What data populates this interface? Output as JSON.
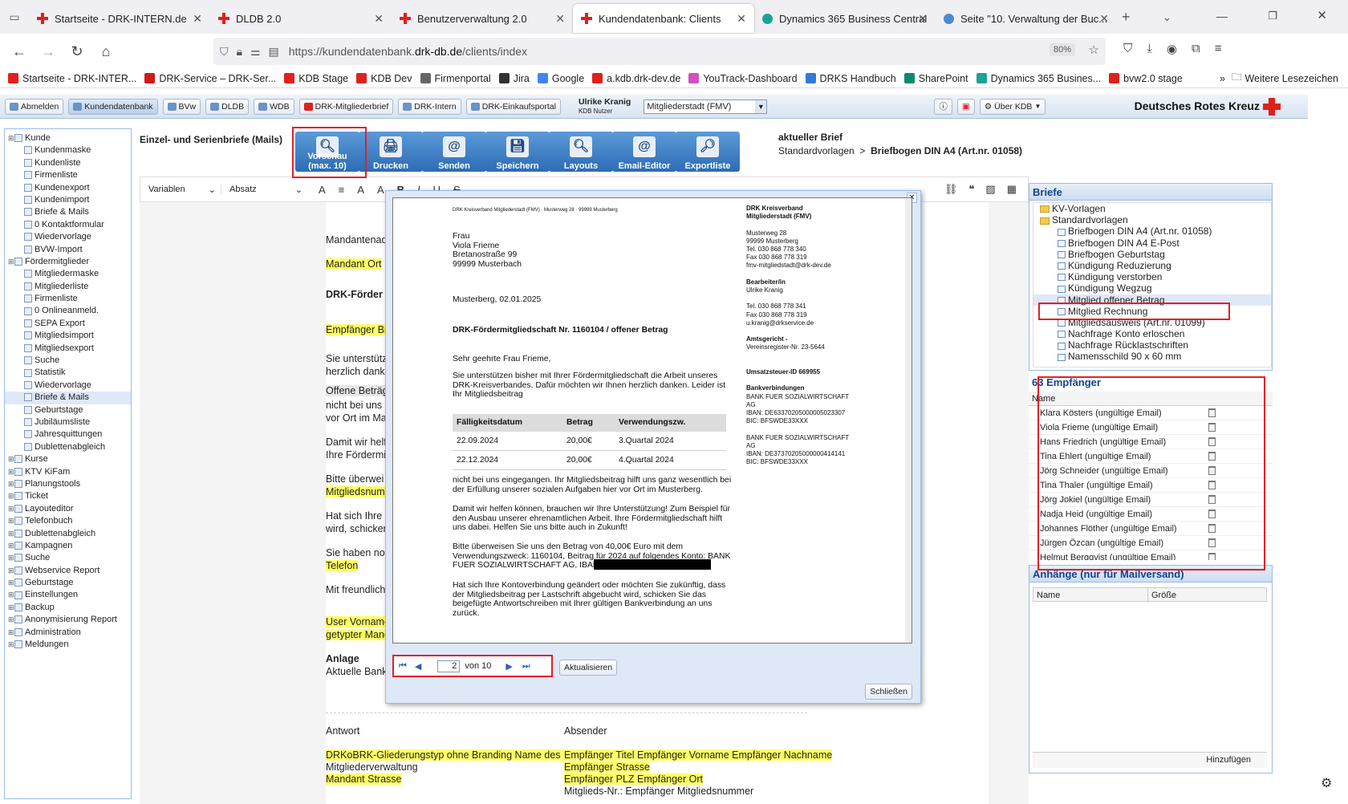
{
  "browser": {
    "tabs": [
      {
        "label": "Startseite - DRK-INTERN.de",
        "icon": "drk-cross-icon"
      },
      {
        "label": "DLDB 2.0",
        "icon": "drk-cross-icon"
      },
      {
        "label": "Benutzerverwaltung 2.0",
        "icon": "drk-cross-icon"
      },
      {
        "label": "Kundendatenbank: Clients",
        "icon": "drk-cross-icon"
      },
      {
        "label": "Dynamics 365 Business Central",
        "icon": "dynamics-icon"
      },
      {
        "label": "Seite \"10. Verwaltung der Buc...",
        "icon": "confluence-icon"
      }
    ],
    "url_prefix": "https://kundendatenbank.",
    "url_domain": "drk-db.de",
    "url_path": "/clients/index",
    "zoom": "80%",
    "bookmarks": [
      "Startseite - DRK-INTER...",
      "DRK-Service – DRK-Ser...",
      "KDB Stage",
      "KDB Dev",
      "Firmenportal",
      "Jira",
      "Google",
      "a.kdb.drk-dev.de",
      "YouTrack-Dashboard",
      "DRKS Handbuch",
      "SharePoint",
      "Dynamics 365 Busines...",
      "bvw2.0 stage"
    ],
    "more_bookmarks": "Weitere Lesezeichen"
  },
  "app_toolbar": {
    "buttons": [
      "Abmelden",
      "Kundendatenbank",
      "BVw",
      "DLDB",
      "WDB",
      "DRK-Mitgliederbrief",
      "DRK-Intern",
      "DRK-Einkaufsportal"
    ],
    "user_name": "Ulrike Kranig",
    "user_role": "KDB Nutzer",
    "org_select": "Mitgliederstadt (FMV)",
    "about": "Über KDB",
    "brand": "Deutsches Rotes Kreuz"
  },
  "sidebar": {
    "items": [
      {
        "label": "Kunde",
        "level": 0
      },
      {
        "label": "Kundenmaske",
        "level": 1
      },
      {
        "label": "Kundenliste",
        "level": 1
      },
      {
        "label": "Firmenliste",
        "level": 1
      },
      {
        "label": "Kundenexport",
        "level": 1
      },
      {
        "label": "Kundenimport",
        "level": 1
      },
      {
        "label": "Briefe & Mails",
        "level": 1
      },
      {
        "label": "0  Kontaktformular",
        "level": 1
      },
      {
        "label": "Wiedervorlage",
        "level": 1
      },
      {
        "label": "BVW-Import",
        "level": 1
      },
      {
        "label": "Fördermitglieder",
        "level": 0
      },
      {
        "label": "Mitgliedermaske",
        "level": 1
      },
      {
        "label": "Mitgliederliste",
        "level": 1
      },
      {
        "label": "Firmenliste",
        "level": 1
      },
      {
        "label": "0  Onlineanmeld.",
        "level": 1
      },
      {
        "label": "SEPA Export",
        "level": 1
      },
      {
        "label": "Mitgliedsimport",
        "level": 1
      },
      {
        "label": "Mitgliedsexport",
        "level": 1
      },
      {
        "label": "Suche",
        "level": 1
      },
      {
        "label": "Statistik",
        "level": 1
      },
      {
        "label": "Wiedervorlage",
        "level": 1
      },
      {
        "label": "Briefe & Mails",
        "level": 1,
        "selected": true
      },
      {
        "label": "Geburtstage",
        "level": 1
      },
      {
        "label": "Jubiläumsliste",
        "level": 1
      },
      {
        "label": "Jahresquittungen",
        "level": 1
      },
      {
        "label": "Dublettenabgleich",
        "level": 1
      },
      {
        "label": "Kurse",
        "level": 0
      },
      {
        "label": "KTV KiFam",
        "level": 0
      },
      {
        "label": "Planungstools",
        "level": 0
      },
      {
        "label": "Ticket",
        "level": 0
      },
      {
        "label": "Layouteditor",
        "level": 0
      },
      {
        "label": "Telefonbuch",
        "level": 0
      },
      {
        "label": "Dublettenabgleich",
        "level": 0
      },
      {
        "label": "Kampagnen",
        "level": 0
      },
      {
        "label": "Suche",
        "level": 0
      },
      {
        "label": "Webservice Report",
        "level": 0
      },
      {
        "label": "Geburtstage",
        "level": 0
      },
      {
        "label": "Einstellungen",
        "level": 0
      },
      {
        "label": "Backup",
        "level": 0
      },
      {
        "label": "Anonymisierung Report",
        "level": 0
      },
      {
        "label": "Administration",
        "level": 0
      },
      {
        "label": "Meldungen",
        "level": 0
      }
    ]
  },
  "main": {
    "title": "Einzel- und Serienbriefe (Mails)",
    "actions": [
      {
        "label": "Vorschau (max. 10)",
        "icon": "preview-icon"
      },
      {
        "label": "Drucken",
        "icon": "print-icon"
      },
      {
        "label": "Senden",
        "icon": "send-icon"
      },
      {
        "label": "Speichern",
        "icon": "save-icon"
      },
      {
        "label": "Layouts",
        "icon": "layouts-icon"
      },
      {
        "label": "Email-Editor",
        "icon": "email-editor-icon"
      },
      {
        "label": "Exportliste",
        "icon": "export-icon"
      }
    ],
    "current_label": "aktueller Brief",
    "current_path": "Standardvorlagen",
    "current_doc": "Briefbogen DIN A4 (Art.nr. 01058)",
    "editor_toolbar": {
      "variables": "Variablen",
      "paragraph": "Absatz"
    },
    "editor_lines": [
      "Mandantenad",
      "Mandant Ort",
      "DRK-Förder",
      "Empfänger Br",
      "Sie unterstütz",
      "herzlich danke",
      "Offene Beträg",
      "nicht bei uns",
      "vor Ort im Ma",
      "Damit wir helf",
      "Ihre Fördermit",
      "Bitte überwei",
      "Mitgliedsnumr",
      "Hat sich Ihre",
      "wird, schicken",
      "Sie haben no",
      "Telefon",
      "Mit freundliche",
      "User Vorname",
      "getypter Mand",
      "Anlage",
      "Aktuelle Bank"
    ],
    "footer_left_head": "Antwort",
    "footer_right_head": "Absender",
    "footer_left": [
      "DRKoBRK-Gliederungstyp ohne Branding Name des Mandanten",
      "Mitgliederverwaltung",
      "Mandant Strasse"
    ],
    "footer_right": [
      "Empfänger Titel Empfänger Vorname Empfänger Nachname",
      "Empfänger Strasse",
      "Empfänger PLZ Empfänger Ort",
      "Mitglieds-Nr.: Empfänger Mitgliedsnummer"
    ]
  },
  "preview": {
    "sender_line": "DRK Kreisverband Mitgliederstadt (FMV) · Musterweg 28 · 99999 Musterberg",
    "recipient": [
      "Frau",
      "Viola Frieme",
      "Bretanostraße 99",
      "99999 Musterbach"
    ],
    "date": "Musterberg, 02.01.2025",
    "subject": "DRK-Fördermitgliedschaft Nr. 1160104 / offener Betrag",
    "salutation": "Sehr geehrte Frau Frieme,",
    "para1": [
      "Sie unterstützen bisher mit Ihrer Fördermitgliedschaft die Arbeit unseres",
      "DRK-Kreisverbandes. Dafür möchten wir Ihnen herzlich danken. Leider ist",
      "Ihr Mitgliedsbeitrag"
    ],
    "table_head": [
      "Fälligkeitsdatum",
      "Betrag",
      "Verwendungszw."
    ],
    "table_rows": [
      [
        "22.09.2024",
        "20,00€",
        "3.Quartal 2024"
      ],
      [
        "22.12.2024",
        "20,00€",
        "4.Quartal 2024"
      ]
    ],
    "para2": [
      "nicht bei uns eingegangen. Ihr Mitgliedsbeitrag hilft uns ganz wesentlich bei",
      "der Erfüllung unserer sozialen Aufgaben hier vor Ort im Musterberg."
    ],
    "para3": [
      "Damit wir helfen können, brauchen wir Ihre Unterstützung! Zum Beispiel für",
      "den Ausbau unserer ehrenamtlichen Arbeit. Ihre Fördermitgliedschaft hilft",
      "uns dabei. Helfen Sie uns bitte auch in Zukunft!"
    ],
    "para4": [
      "Bitte überweisen Sie uns den Betrag von 40,00€ Euro mit dem",
      "Verwendungszweck: 1160104, Beitrag für 2024 auf folgendes Konto: BANK",
      "FUER SOZIALWIRTSCHAFT AG, IBAN"
    ],
    "para5": [
      "Hat sich Ihre Kontoverbindung geändert oder möchten Sie zukünftig, dass",
      "der Mitgliedsbeitrag per Lastschrift abgebucht wird, schicken Sie das",
      "beigefügte Antwortschreiben mit Ihrer gültigen Bankverbindung an uns",
      "zurück."
    ],
    "right_col": [
      {
        "text": "DRK Kreisverband",
        "bold": true
      },
      {
        "text": "Mitgliederstadt (FMV)",
        "bold": true
      },
      {
        "text": ""
      },
      {
        "text": "Musterweg 28"
      },
      {
        "text": "99999 Musterberg"
      },
      {
        "text": "Tel. 030 868 778 340"
      },
      {
        "text": "Fax 030 868 778 319"
      },
      {
        "text": "fmv-mitgliedstadt@drk-dev.de"
      },
      {
        "text": ""
      },
      {
        "text": "Bearbeiter/in",
        "bold": true
      },
      {
        "text": "Ulrike Kranig"
      },
      {
        "text": ""
      },
      {
        "text": "Tel. 030 868 778 341"
      },
      {
        "text": "Fax 030 868 778 319"
      },
      {
        "text": "u.kranig@drkservice.de"
      },
      {
        "text": ""
      },
      {
        "text": "Amtsgericht -",
        "bold": true
      },
      {
        "text": "Vereinsregister-Nr. 23-5644"
      },
      {
        "text": ""
      },
      {
        "text": ""
      },
      {
        "text": "Umsatzsteuer-ID 669955",
        "bold": true
      },
      {
        "text": ""
      },
      {
        "text": "Bankverbindungen",
        "bold": true
      },
      {
        "text": "BANK FUER SOZIALWIRTSCHAFT"
      },
      {
        "text": "AG"
      },
      {
        "text": "IBAN: DE63370205000005023307"
      },
      {
        "text": "BIC: BFSWDE33XXX"
      },
      {
        "text": ""
      },
      {
        "text": "BANK FUER SOZIALWIRTSCHAFT"
      },
      {
        "text": "AG"
      },
      {
        "text": "IBAN: DE37370205000000414141"
      },
      {
        "text": "BIC: BFSWDE33XXX"
      }
    ],
    "page_current": "2",
    "page_of": "von 10",
    "refresh": "Aktualisieren",
    "close": "Schließen"
  },
  "right": {
    "letters_title": "Briefe",
    "tree": [
      {
        "label": "KV-Vorlagen",
        "folder": true,
        "level": 0
      },
      {
        "label": "Standardvorlagen",
        "folder": true,
        "level": 0
      },
      {
        "label": "Briefbogen DIN A4 (Art.nr. 01058)",
        "level": 1
      },
      {
        "label": "Briefbogen DIN A4 E-Post",
        "level": 1
      },
      {
        "label": "Briefbogen Geburtstag",
        "level": 1
      },
      {
        "label": "Kündigung Reduzierung",
        "level": 1
      },
      {
        "label": "Kündigung verstorben",
        "level": 1
      },
      {
        "label": "Kündigung Wegzug",
        "level": 1
      },
      {
        "label": "Mitglied offener Betrag",
        "level": 1,
        "selected": true
      },
      {
        "label": "Mitglied Rechnung",
        "level": 1
      },
      {
        "label": "Mitgliedsausweis (Art.nr. 01099)",
        "level": 1
      },
      {
        "label": "Nachfrage Konto erloschen",
        "level": 1
      },
      {
        "label": "Nachfrage Rücklastschriften",
        "level": 1
      },
      {
        "label": "Namensschild 90 x 60 mm",
        "level": 1
      }
    ],
    "recipients_title": "63 Empfänger",
    "recipients_col": "Name",
    "recipients": [
      "Klara Kösters (ungültige Email)",
      "Viola Frieme (ungültige Email)",
      "Hans Friedrich (ungültige Email)",
      "Tina Ehlert (ungültige Email)",
      "Jörg Schneider (ungültige Email)",
      "Tina Thaler (ungültige Email)",
      "Jörg Jokiel (ungültige Email)",
      "Nadja Heid (ungültige Email)",
      "Johannes Flöther (ungültige Email)",
      "Jürgen Özcan (ungültige Email)",
      "Helmut Bergqvist (ungültige Email)"
    ],
    "attachments_title": "Anhänge (nur für Mailversand)",
    "att_col_name": "Name",
    "att_col_size": "Größe",
    "add": "Hinzufügen"
  }
}
